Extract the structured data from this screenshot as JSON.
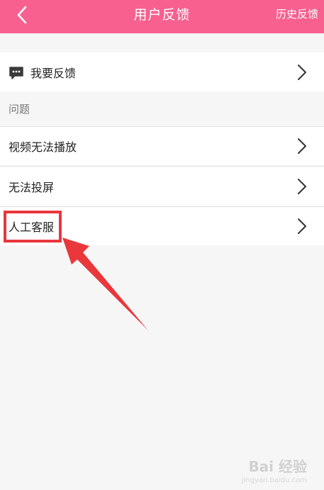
{
  "header": {
    "title": "用户反馈",
    "history_label": "历史反馈",
    "background_color": "#f7608f",
    "back_icon": "chevron-left-icon"
  },
  "feedback": {
    "label": "我要反馈",
    "icon": "message-icon"
  },
  "section": {
    "title": "问题"
  },
  "questions": [
    {
      "label": "视频无法播放"
    },
    {
      "label": "无法投屏"
    },
    {
      "label": "人工客服"
    }
  ],
  "annotation": {
    "color": "#e9373c"
  },
  "watermark": {
    "text": "Bai 经验",
    "sub": "jingyan.baidu.com"
  }
}
